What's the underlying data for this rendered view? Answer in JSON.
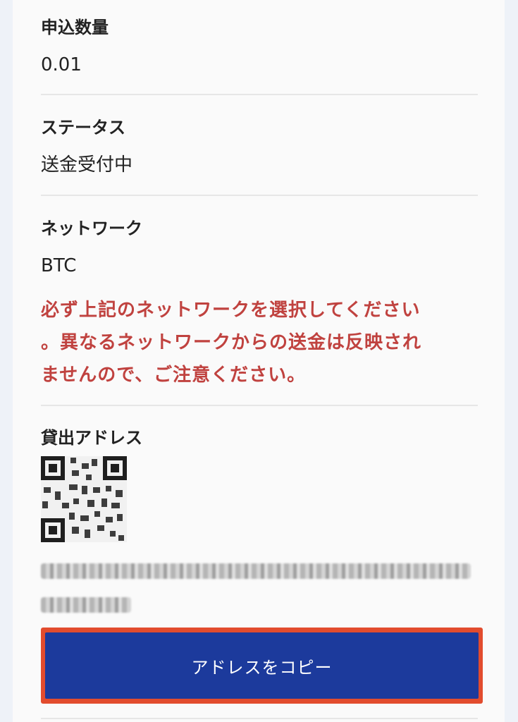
{
  "fields": {
    "quantity": {
      "label": "申込数量",
      "value": "0.01"
    },
    "status": {
      "label": "ステータス",
      "value": "送金受付中"
    },
    "network": {
      "label": "ネットワーク",
      "value": "BTC",
      "warning_line1": "必ず上記のネットワークを選択してください",
      "warning_line2": "。異なるネットワークからの送金は反映され",
      "warning_line3": "ませんので、ご注意ください。"
    },
    "address": {
      "label": "貸出アドレス"
    }
  },
  "copy_button_label": "アドレスをコピー",
  "colors": {
    "warning": "#c0423f",
    "button": "#1c3a9c",
    "highlight_border": "#e24c2e"
  }
}
